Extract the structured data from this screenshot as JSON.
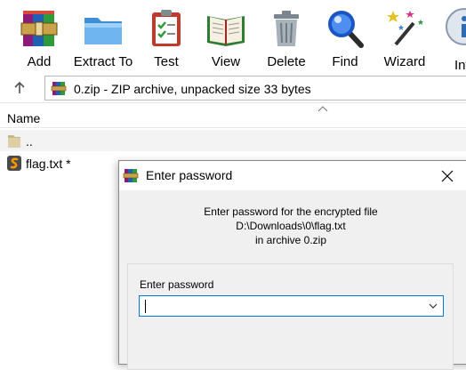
{
  "toolbar": {
    "items": [
      {
        "label": "Add",
        "icon": "winrar-add-icon"
      },
      {
        "label": "Extract To",
        "icon": "folder-extract-icon"
      },
      {
        "label": "Test",
        "icon": "clipboard-check-icon"
      },
      {
        "label": "View",
        "icon": "open-book-icon"
      },
      {
        "label": "Delete",
        "icon": "trash-can-icon"
      },
      {
        "label": "Find",
        "icon": "magnifier-icon"
      },
      {
        "label": "Wizard",
        "icon": "magic-wand-icon"
      },
      {
        "label": "Inf",
        "icon": "info-icon"
      }
    ]
  },
  "address": {
    "text": "0.zip - ZIP archive, unpacked size 33 bytes"
  },
  "filelist": {
    "column_name": "Name",
    "rows": [
      {
        "name": ".."
      },
      {
        "name": "flag.txt *"
      }
    ]
  },
  "dialog": {
    "title": "Enter password",
    "message_line1": "Enter password for the encrypted file",
    "message_line2": "D:\\Downloads\\0\\flag.txt",
    "message_line3": "in archive 0.zip",
    "field_label": "Enter password",
    "password_value": ""
  },
  "colors": {
    "focus_border": "#0078d7",
    "dialog_bg": "#f0f0f0",
    "selected_row_bg": "#f3f3f3"
  }
}
